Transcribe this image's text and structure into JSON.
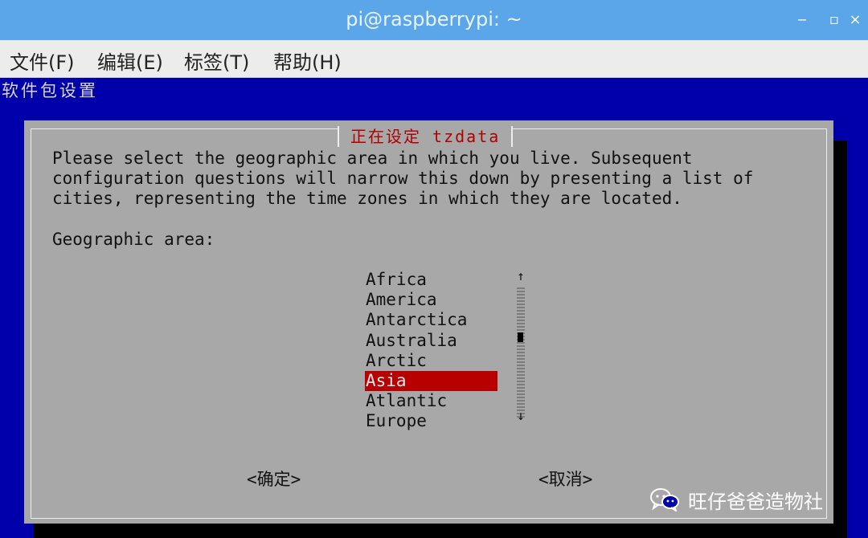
{
  "window": {
    "title": "pi@raspberrypi: ~",
    "minimize": "‒",
    "maximize": "▫",
    "close": "×"
  },
  "menubar": [
    "文件(F)",
    "编辑(E)",
    "标签(T)",
    "帮助(H)"
  ],
  "terminal": {
    "header": "软件包设置",
    "dialog": {
      "title": "正在设定 tzdata",
      "description": "Please select the geographic area in which you live. Subsequent\nconfiguration questions will narrow this down by presenting a list of\ncities, representing the time zones in which they are located.",
      "area_label": "Geographic area:",
      "areas": [
        "Africa",
        "America",
        "Antarctica",
        "Australia",
        "Arctic",
        "Asia",
        "Atlantic",
        "Europe"
      ],
      "selected_area": "Asia",
      "scroll_up": "↑",
      "scroll_down": "↓",
      "ok_button": "<确定>",
      "cancel_button": "<取消>"
    }
  },
  "watermark": {
    "text": "旺仔爸爸造物社"
  },
  "colors": {
    "terminal_bg": "#0000aa",
    "dialog_bg": "#a8a8a8",
    "selection": "#b80000",
    "titlebar": "#5aa6e8"
  }
}
